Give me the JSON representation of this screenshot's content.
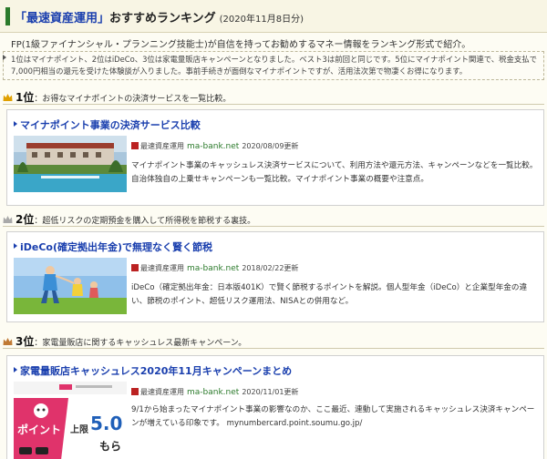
{
  "header": {
    "link_title": "「最速資産運用」",
    "title_suffix": "おすすめランキング",
    "date": "(2020年11月8日分)"
  },
  "intro": "FP(1級ファイナンシャル・プランニング技能士)が自信を持ってお勧めするマネー情報をランキング形式で紹介。",
  "notice": "1位はマイナポイント、2位はiDeCo、3位は家電量販店キャンペーンとなりました。ベスト3は前回と同じです。5位にマイナポイント関連で、税金支払で7,000円相当の還元を受けた体験談が入りました。事前手続きが面倒なマイナポイントですが、活用法次第で物凄くお得になります。",
  "ranks": [
    {
      "rank": "1位",
      "summary": "お得なマイナポイントの決済サービスを一覧比較。",
      "card": {
        "title": "マイナポイント事業の決済サービス比較",
        "source": "最速資産運用",
        "site": "ma-bank.net",
        "updated": "2020/08/09更新",
        "desc": "マイナポイント事業のキャッシュレス決済サービスについて、利用方法や還元方法、キャンペーンなどを一覧比較。自治体独自の上乗せキャンペーンも一覧比較。マイナポイント事業の概要や注意点。"
      }
    },
    {
      "rank": "2位",
      "summary": "超低リスクの定期預金を購入して所得税を節税する裏技。",
      "card": {
        "title": "iDeCo(確定拠出年金)で無理なく賢く節税",
        "source": "最速資産運用",
        "site": "ma-bank.net",
        "updated": "2018/02/22更新",
        "desc": "iDeCo（確定拠出年金：日本版401K）で賢く節税するポイントを解説。個人型年金（iDeCo）と企業型年金の違い、節税のポイント、超低リスク運用法、NISAとの併用など。"
      }
    },
    {
      "rank": "3位",
      "summary": "家電量販店に関するキャッシュレス最新キャンペーン。",
      "card": {
        "title": "家電量販店キャッシュレス2020年11月キャンペーンまとめ",
        "source": "最速資産運用",
        "site": "ma-bank.net",
        "updated": "2020/11/01更新",
        "desc": "9/1から始まったマイナポイント事業の影響なのか、ここ最近、連動して実施されるキャッシュレス決済キャンペーンが増えている印象です。 mynumbercard.point.soumu.go.jp/",
        "thumb_text1": "ポイント",
        "thumb_text2": "上限",
        "thumb_text3": "5.0",
        "thumb_text4": "もら"
      }
    }
  ],
  "colors": {
    "link": "#1a3fae",
    "site": "#2b7a2b",
    "crown_gold": "#e0a000",
    "crown_silver": "#a9a9a9",
    "crown_bronze": "#c07a35"
  }
}
